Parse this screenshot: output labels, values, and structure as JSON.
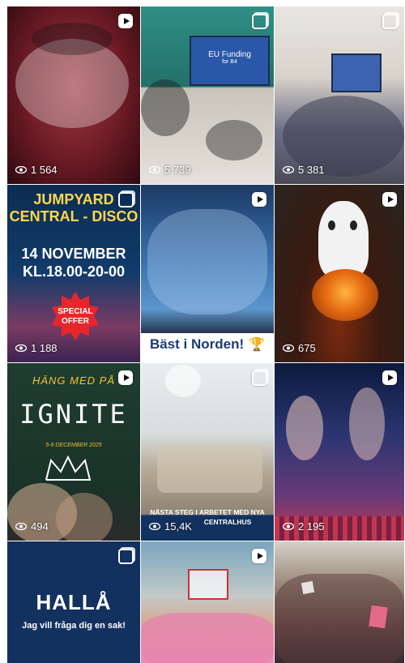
{
  "tiles": [
    {
      "type": "reel",
      "views": "1 564"
    },
    {
      "type": "multi",
      "views": "5 739",
      "screen_title": "EU Funding",
      "screen_subtitle": "for B4"
    },
    {
      "type": "multi",
      "views": "5 381"
    },
    {
      "type": "multi",
      "views": "1 188",
      "heading_line1": "JUMPYARD",
      "heading_line2": "CENTRAL - DISCO",
      "date_line1": "14 NOVEMBER",
      "date_line2": "KL.18.00-20-00",
      "offer_line1": "SPECIAL",
      "offer_line2": "OFFER"
    },
    {
      "type": "reel",
      "views": "",
      "caption": "Bäst i Norden!"
    },
    {
      "type": "reel",
      "views": "675"
    },
    {
      "type": "reel",
      "views": "494",
      "top_text": "HÄNG MED PÅ",
      "title": "IGNITE",
      "dates": "5-9 DECEMBER 2025"
    },
    {
      "type": "multi",
      "views": "15,4K",
      "caption_line1": "NÄSTA STEG I ARBETET MED NYA",
      "caption_line2": "CENTRALHUS"
    },
    {
      "type": "reel",
      "views": "2 195"
    },
    {
      "type": "multi",
      "views": "",
      "title": "HALLÅ",
      "subtitle": "Jag vill fråga dig en sak!"
    },
    {
      "type": "reel",
      "views": ""
    },
    {
      "type": "none",
      "views": ""
    }
  ],
  "colors": {
    "offer_red": "#e8262a",
    "navy": "#13315f",
    "ignite_yellow": "#f2c230"
  },
  "icons": {
    "reel": "reel-icon",
    "multi": "carousel-icon",
    "views": "eye-icon",
    "trophy": "trophy-icon"
  }
}
